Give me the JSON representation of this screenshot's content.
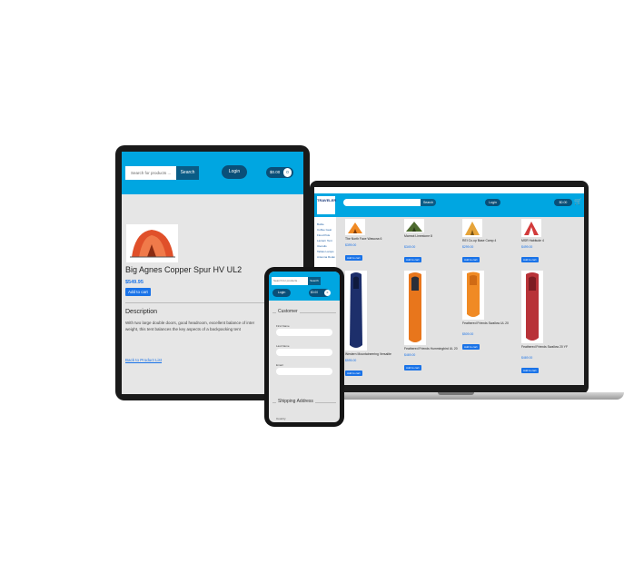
{
  "laptop": {
    "logo": "TRAVELER",
    "search_button": "Search",
    "login": "Login",
    "cart": "$0.00",
    "sidebar": [
      "Bottle",
      "Coffee Gear",
      "Flood Pole",
      "Lantern Tent",
      "Utensils",
      "Tables Lamps",
      "Antenna Rodents"
    ],
    "products": [
      {
        "name": "The North Face Wawona 6",
        "price": "$399.00",
        "add": "Add to cart",
        "color": "#f08a24"
      },
      {
        "name": "Marmot Limestone 8",
        "price": "$349.00",
        "add": "Add to cart",
        "color": "#4e6b2f"
      },
      {
        "name": "REI Co-op Base Camp 4",
        "price": "$299.00",
        "add": "Add to cart",
        "color": "#e6a43a"
      },
      {
        "name": "MSR Habitude 4",
        "price": "$499.00",
        "add": "Add to cart",
        "color": "#d23b3b"
      },
      {
        "name": "Western Mountaineering Versalite",
        "price": "$595.00",
        "add": "Add to cart",
        "color": "#1d2f6b"
      },
      {
        "name": "Feathered Friends Hummingbird UL 20",
        "price": "$469.00",
        "add": "Add to cart",
        "color": "#e8761c"
      },
      {
        "name": "Feathered Friends Swallow UL 20",
        "price": "$509.00",
        "add": "Add to cart",
        "color": "#f08a24"
      },
      {
        "name": "Feathered Friends Swallow 20 YF",
        "price": "$469.00",
        "add": "Add to cart",
        "color": "#b83238"
      }
    ]
  },
  "tablet": {
    "search_placeholder": "Search for products ...",
    "search_button": "Search",
    "login": "Login",
    "cart": "$0.00",
    "cart_count": "0",
    "product_title": "Big Agnes Copper Spur HV UL2",
    "price": "$549.95",
    "add_to_cart": "Add to cart",
    "description_heading": "Description",
    "description_line1": "With two large double doors, good headroom, excellent balance of inter",
    "description_line2": "weight, this tent balances the key aspects of a backpacking tent",
    "back_link": "Back to Product List",
    "tent_color": "#e0502a"
  },
  "phone": {
    "search_placeholder": "Search for products...",
    "search_button": "Search",
    "login": "Login",
    "cart": "$0.00",
    "cart_count": "0",
    "customer_heading": "Customer",
    "first_name_label": "First Name",
    "last_name_label": "Last Name",
    "email_label": "Email",
    "shipping_heading": "Shipping Address",
    "country_label": "Country"
  }
}
